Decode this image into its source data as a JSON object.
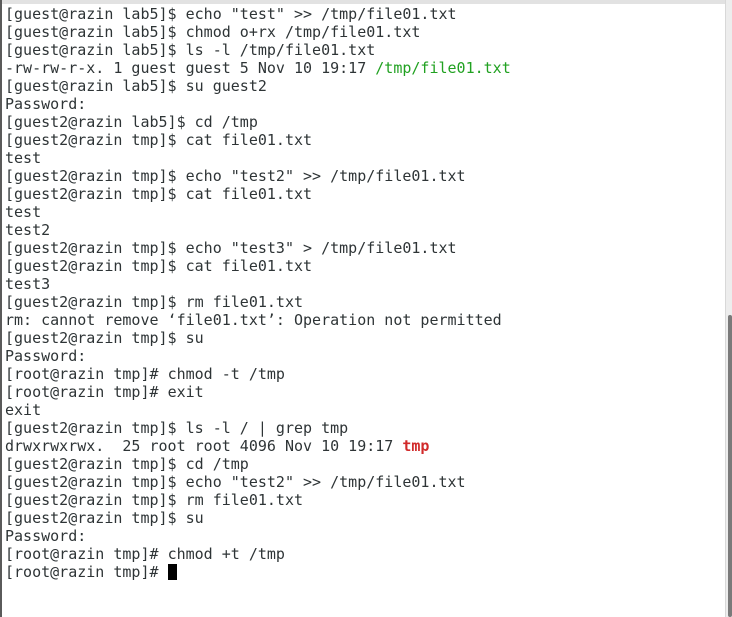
{
  "terminal": {
    "lines": [
      {
        "prompt": "[guest@razin lab5]$ ",
        "command": "echo \"test\" >> /tmp/file01.txt"
      },
      {
        "prompt": "[guest@razin lab5]$ ",
        "command": "chmod o+rx /tmp/file01.txt"
      },
      {
        "prompt": "[guest@razin lab5]$ ",
        "command": "ls -l /tmp/file01.txt"
      },
      {
        "output": "-rw-rw-r-x. 1 guest guest 5 Nov 10 19:17 ",
        "highlight": "/tmp/file01.txt",
        "highlight_color": "#21a121"
      },
      {
        "prompt": "[guest@razin lab5]$ ",
        "command": "su guest2"
      },
      {
        "output": "Password:"
      },
      {
        "prompt": "[guest2@razin lab5]$ ",
        "command": "cd /tmp"
      },
      {
        "prompt": "[guest2@razin tmp]$ ",
        "command": "cat file01.txt"
      },
      {
        "output": "test"
      },
      {
        "prompt": "[guest2@razin tmp]$ ",
        "command": "echo \"test2\" >> /tmp/file01.txt"
      },
      {
        "prompt": "[guest2@razin tmp]$ ",
        "command": "cat file01.txt"
      },
      {
        "output": "test"
      },
      {
        "output": "test2"
      },
      {
        "prompt": "[guest2@razin tmp]$ ",
        "command": "echo \"test3\" > /tmp/file01.txt"
      },
      {
        "prompt": "[guest2@razin tmp]$ ",
        "command": "cat file01.txt"
      },
      {
        "output": "test3"
      },
      {
        "prompt": "[guest2@razin tmp]$ ",
        "command": "rm file01.txt"
      },
      {
        "output": "rm: cannot remove ‘file01.txt’: Operation not permitted"
      },
      {
        "prompt": "[guest2@razin tmp]$ ",
        "command": "su"
      },
      {
        "output": "Password:"
      },
      {
        "prompt": "[root@razin tmp]# ",
        "command": "chmod -t /tmp"
      },
      {
        "prompt": "[root@razin tmp]# ",
        "command": "exit"
      },
      {
        "output": "exit"
      },
      {
        "prompt": "[guest2@razin tmp]$ ",
        "command": "ls -l / | grep tmp"
      },
      {
        "output": "drwxrwxrwx.  25 root root 4096 Nov 10 19:17 ",
        "highlight": "tmp",
        "highlight_color": "#d12a2a"
      },
      {
        "prompt": "[guest2@razin tmp]$ ",
        "command": "cd /tmp"
      },
      {
        "prompt": "[guest2@razin tmp]$ ",
        "command": "echo \"test2\" >> /tmp/file01.txt"
      },
      {
        "prompt": "[guest2@razin tmp]$ ",
        "command": "rm file01.txt"
      },
      {
        "prompt": "[guest2@razin tmp]$ ",
        "command": "su"
      },
      {
        "output": "Password:"
      },
      {
        "prompt": "[root@razin tmp]# ",
        "command": "chmod +t /tmp"
      },
      {
        "prompt": "[root@razin tmp]# ",
        "command": "",
        "cursor": true
      }
    ]
  },
  "colors": {
    "background": "#ffffff",
    "text": "#2e3436",
    "file_highlight": "#21a121",
    "dir_highlight": "#d12a2a",
    "cursor": "#000000"
  },
  "scrollbar": {
    "position_fraction": 0.51,
    "visible_fraction": 0.49
  }
}
